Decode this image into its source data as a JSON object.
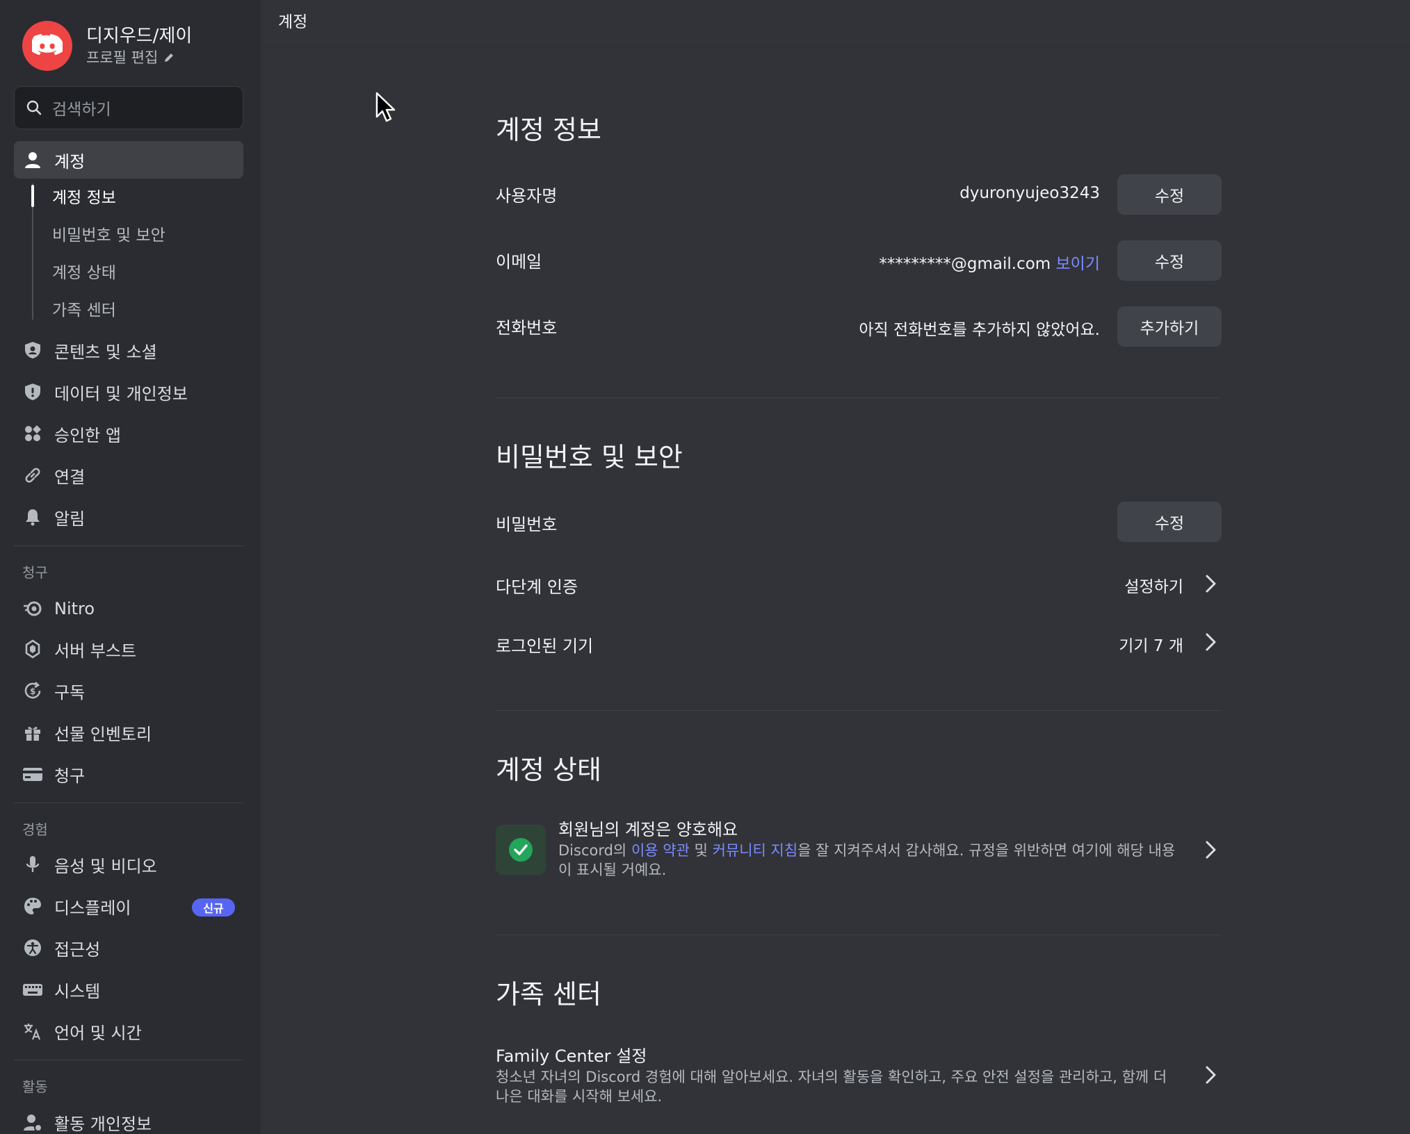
{
  "profile": {
    "name": "디지우드/제이",
    "edit_label": "프로필 편집"
  },
  "search": {
    "placeholder": "검색하기"
  },
  "sidebar": {
    "account": "계정",
    "sub_items": [
      "계정 정보",
      "비밀번호 및 보안",
      "계정 상태",
      "가족 센터"
    ],
    "items_user": [
      "콘텐츠 및 소셜",
      "데이터 및 개인정보",
      "승인한 앱",
      "연결",
      "알림"
    ],
    "billing_label": "청구",
    "items_billing": [
      "Nitro",
      "서버 부스트",
      "구독",
      "선물 인벤토리",
      "청구"
    ],
    "experience_label": "경험",
    "items_experience": [
      "음성 및 비디오",
      "디스플레이",
      "접근성",
      "시스템",
      "언어 및 시간"
    ],
    "new_badge": "신규",
    "activity_label": "활동",
    "items_activity": [
      "활동 개인정보"
    ]
  },
  "topbar": {
    "title": "계정"
  },
  "account_info": {
    "title": "계정 정보",
    "username_label": "사용자명",
    "username_value": "dyuronyujeo3243",
    "email_label": "이메일",
    "email_value": "*********@gmail.com",
    "email_reveal": "보이기",
    "phone_label": "전화번호",
    "phone_value": "아직 전화번호를 추가하지 않았어요.",
    "edit_button": "수정",
    "add_button": "추가하기"
  },
  "security": {
    "title": "비밀번호 및 보안",
    "password_label": "비밀번호",
    "mfa_label": "다단계 인증",
    "mfa_action": "설정하기",
    "devices_label": "로그인된 기기",
    "devices_value": "기기 7 개"
  },
  "account_status": {
    "title": "계정 상태",
    "status_title": "회원님의 계정은 양호해요",
    "desc_prefix": "Discord의 ",
    "terms_link": "이용 약관",
    "desc_and": " 및 ",
    "guidelines_link": "커뮤니티 지침",
    "desc_suffix": "을 잘 지켜주셔서 감사해요. 규정을 위반하면 여기에 해당 내용이 표시될 거예요."
  },
  "family_center": {
    "title": "가족 센터",
    "item_title": "Family Center 설정",
    "item_desc": "청소년 자녀의 Discord 경험에 대해 알아보세요. 자녀의 활동을 확인하고, 주요 안전 설정을 관리하고, 함께 더 나은 대화를 시작해 보세요."
  },
  "colors": {
    "accent": "#5865f2",
    "link": "#7b8cff",
    "success": "#23a55a",
    "brand": "#ef4444"
  }
}
